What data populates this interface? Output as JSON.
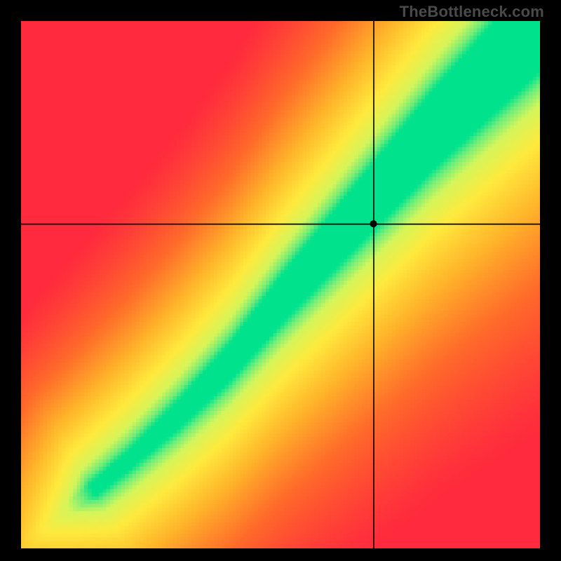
{
  "watermark": "TheBottleneck.com",
  "chart_data": {
    "type": "heatmap",
    "title": "",
    "xlabel": "",
    "ylabel": "",
    "xlim": [
      0,
      1
    ],
    "ylim": [
      0,
      1
    ],
    "crosshair": {
      "x": 0.68,
      "y": 0.615
    },
    "marker": {
      "x": 0.68,
      "y": 0.615,
      "radius": 5
    },
    "ridge_points": [
      {
        "x": 0.0,
        "y": 0.0
      },
      {
        "x": 0.1,
        "y": 0.08
      },
      {
        "x": 0.2,
        "y": 0.16
      },
      {
        "x": 0.3,
        "y": 0.25
      },
      {
        "x": 0.4,
        "y": 0.35
      },
      {
        "x": 0.5,
        "y": 0.47
      },
      {
        "x": 0.6,
        "y": 0.58
      },
      {
        "x": 0.7,
        "y": 0.69
      },
      {
        "x": 0.8,
        "y": 0.8
      },
      {
        "x": 0.9,
        "y": 0.9
      },
      {
        "x": 1.0,
        "y": 1.0
      }
    ],
    "ridge_width_points": [
      {
        "x": 0.0,
        "w": 0.008
      },
      {
        "x": 0.2,
        "w": 0.018
      },
      {
        "x": 0.4,
        "w": 0.035
      },
      {
        "x": 0.6,
        "w": 0.055
      },
      {
        "x": 0.8,
        "w": 0.075
      },
      {
        "x": 1.0,
        "w": 0.095
      }
    ],
    "color_stops": [
      {
        "t": 0.0,
        "color": "#ff2a3d"
      },
      {
        "t": 0.3,
        "color": "#ff6a2a"
      },
      {
        "t": 0.55,
        "color": "#ffb52a"
      },
      {
        "t": 0.75,
        "color": "#ffe93d"
      },
      {
        "t": 0.88,
        "color": "#d4f55a"
      },
      {
        "t": 0.95,
        "color": "#70ed7a"
      },
      {
        "t": 1.0,
        "color": "#00e28c"
      }
    ],
    "grid_resolution": 140
  }
}
